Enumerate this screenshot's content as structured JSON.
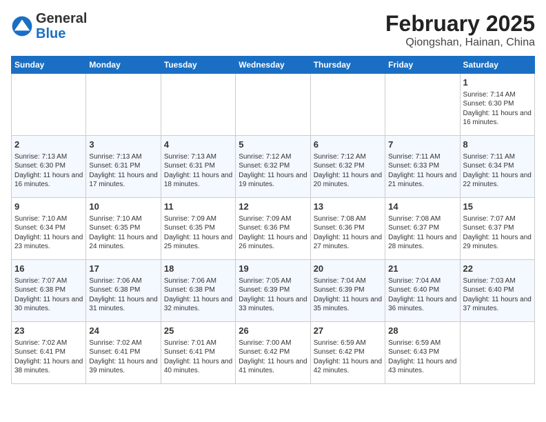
{
  "header": {
    "logo_general": "General",
    "logo_blue": "Blue",
    "title": "February 2025",
    "subtitle": "Qiongshan, Hainan, China"
  },
  "days_of_week": [
    "Sunday",
    "Monday",
    "Tuesday",
    "Wednesday",
    "Thursday",
    "Friday",
    "Saturday"
  ],
  "weeks": [
    [
      {
        "day": "",
        "info": ""
      },
      {
        "day": "",
        "info": ""
      },
      {
        "day": "",
        "info": ""
      },
      {
        "day": "",
        "info": ""
      },
      {
        "day": "",
        "info": ""
      },
      {
        "day": "",
        "info": ""
      },
      {
        "day": "1",
        "info": "Sunrise: 7:14 AM\nSunset: 6:30 PM\nDaylight: 11 hours and 16 minutes."
      }
    ],
    [
      {
        "day": "2",
        "info": "Sunrise: 7:13 AM\nSunset: 6:30 PM\nDaylight: 11 hours and 16 minutes."
      },
      {
        "day": "3",
        "info": "Sunrise: 7:13 AM\nSunset: 6:31 PM\nDaylight: 11 hours and 17 minutes."
      },
      {
        "day": "4",
        "info": "Sunrise: 7:13 AM\nSunset: 6:31 PM\nDaylight: 11 hours and 18 minutes."
      },
      {
        "day": "5",
        "info": "Sunrise: 7:12 AM\nSunset: 6:32 PM\nDaylight: 11 hours and 19 minutes."
      },
      {
        "day": "6",
        "info": "Sunrise: 7:12 AM\nSunset: 6:32 PM\nDaylight: 11 hours and 20 minutes."
      },
      {
        "day": "7",
        "info": "Sunrise: 7:11 AM\nSunset: 6:33 PM\nDaylight: 11 hours and 21 minutes."
      },
      {
        "day": "8",
        "info": "Sunrise: 7:11 AM\nSunset: 6:34 PM\nDaylight: 11 hours and 22 minutes."
      }
    ],
    [
      {
        "day": "9",
        "info": "Sunrise: 7:10 AM\nSunset: 6:34 PM\nDaylight: 11 hours and 23 minutes."
      },
      {
        "day": "10",
        "info": "Sunrise: 7:10 AM\nSunset: 6:35 PM\nDaylight: 11 hours and 24 minutes."
      },
      {
        "day": "11",
        "info": "Sunrise: 7:09 AM\nSunset: 6:35 PM\nDaylight: 11 hours and 25 minutes."
      },
      {
        "day": "12",
        "info": "Sunrise: 7:09 AM\nSunset: 6:36 PM\nDaylight: 11 hours and 26 minutes."
      },
      {
        "day": "13",
        "info": "Sunrise: 7:08 AM\nSunset: 6:36 PM\nDaylight: 11 hours and 27 minutes."
      },
      {
        "day": "14",
        "info": "Sunrise: 7:08 AM\nSunset: 6:37 PM\nDaylight: 11 hours and 28 minutes."
      },
      {
        "day": "15",
        "info": "Sunrise: 7:07 AM\nSunset: 6:37 PM\nDaylight: 11 hours and 29 minutes."
      }
    ],
    [
      {
        "day": "16",
        "info": "Sunrise: 7:07 AM\nSunset: 6:38 PM\nDaylight: 11 hours and 30 minutes."
      },
      {
        "day": "17",
        "info": "Sunrise: 7:06 AM\nSunset: 6:38 PM\nDaylight: 11 hours and 31 minutes."
      },
      {
        "day": "18",
        "info": "Sunrise: 7:06 AM\nSunset: 6:38 PM\nDaylight: 11 hours and 32 minutes."
      },
      {
        "day": "19",
        "info": "Sunrise: 7:05 AM\nSunset: 6:39 PM\nDaylight: 11 hours and 33 minutes."
      },
      {
        "day": "20",
        "info": "Sunrise: 7:04 AM\nSunset: 6:39 PM\nDaylight: 11 hours and 35 minutes."
      },
      {
        "day": "21",
        "info": "Sunrise: 7:04 AM\nSunset: 6:40 PM\nDaylight: 11 hours and 36 minutes."
      },
      {
        "day": "22",
        "info": "Sunrise: 7:03 AM\nSunset: 6:40 PM\nDaylight: 11 hours and 37 minutes."
      }
    ],
    [
      {
        "day": "23",
        "info": "Sunrise: 7:02 AM\nSunset: 6:41 PM\nDaylight: 11 hours and 38 minutes."
      },
      {
        "day": "24",
        "info": "Sunrise: 7:02 AM\nSunset: 6:41 PM\nDaylight: 11 hours and 39 minutes."
      },
      {
        "day": "25",
        "info": "Sunrise: 7:01 AM\nSunset: 6:41 PM\nDaylight: 11 hours and 40 minutes."
      },
      {
        "day": "26",
        "info": "Sunrise: 7:00 AM\nSunset: 6:42 PM\nDaylight: 11 hours and 41 minutes."
      },
      {
        "day": "27",
        "info": "Sunrise: 6:59 AM\nSunset: 6:42 PM\nDaylight: 11 hours and 42 minutes."
      },
      {
        "day": "28",
        "info": "Sunrise: 6:59 AM\nSunset: 6:43 PM\nDaylight: 11 hours and 43 minutes."
      },
      {
        "day": "",
        "info": ""
      }
    ]
  ]
}
